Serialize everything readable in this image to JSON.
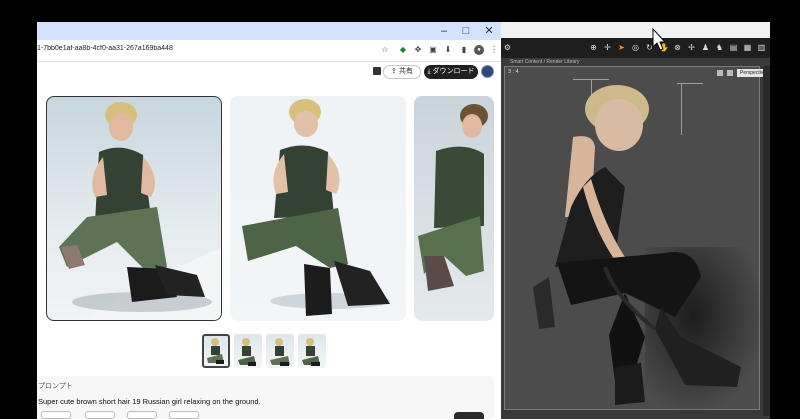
{
  "browser": {
    "url": "1-7bb0e1af-aa8b-4cf0-aa31-267a169ba448",
    "window_controls": [
      "–",
      "□",
      "✕"
    ],
    "toolbar_icons": [
      "star-icon",
      "extension-icon",
      "puzzle-icon",
      "sidebar-icon",
      "profile-icon",
      "more-icon"
    ]
  },
  "appbar": {
    "share_label": "共有",
    "download_label": "ダウンロード"
  },
  "gallery": {
    "cards": [
      "result-image-1",
      "result-image-2",
      "result-image-3"
    ],
    "thumbnails": [
      "thumb-1",
      "thumb-2",
      "thumb-3",
      "thumb-4"
    ],
    "selected_thumbnail": "thumb-1"
  },
  "prompt": {
    "label": "プロンプト",
    "text": "Super cute brown short hair 19 Russian girl relaxing on the ground."
  },
  "app3d": {
    "library_tab": "Smart Content / Render Library",
    "viewport_label": "3 : 4",
    "camera_label": "Perspective View",
    "accent_color": "#ff8a2a"
  }
}
